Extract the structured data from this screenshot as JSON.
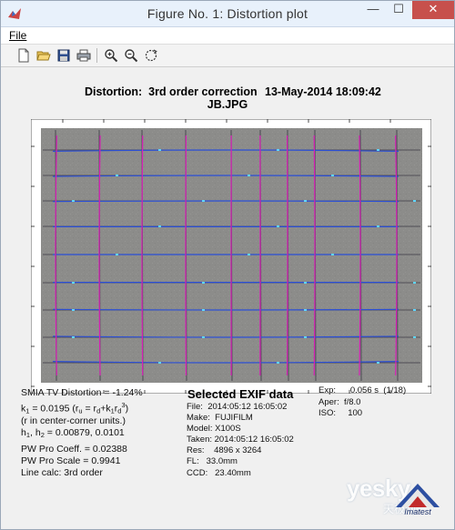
{
  "window": {
    "title": "Figure No. 1: Distortion plot"
  },
  "window_controls": {
    "minimize": "—",
    "maximize": "☐",
    "close": "✕"
  },
  "menu": {
    "file": "File"
  },
  "toolbar": {
    "icons": [
      "new-file-icon",
      "open-folder-icon",
      "save-disk-icon",
      "print-icon",
      "zoom-in-icon",
      "zoom-out-icon",
      "rotate-icon"
    ]
  },
  "plot": {
    "title_line1": "Distortion:  3rd order correction",
    "date": "13-May-2014 18:09:42",
    "file": "JB.JPG",
    "line_colors": {
      "horizontal": "#2b4fd6",
      "vertical": "#d81fb7",
      "highlight": "#5fd6ff"
    }
  },
  "stats": {
    "smia": "SMIA TV Distortion = -1.24%",
    "k1_prefix": "k",
    "k1_sub": "1",
    "k1_value": " = 0.0195  (r",
    "k1_ru_sub": "u",
    "k1_eq": " = r",
    "k1_rd_sub": "d",
    "k1_plus": "+k",
    "k1_k_sub": "1",
    "k1_r": "r",
    "k1_rd3": "d",
    "k1_exp": "3",
    "k1_close": ")",
    "r_units": "(r in center-corner units.)",
    "h_prefix": "h",
    "h1_sub": "1",
    "h_mid": ", h",
    "h2_sub": "2",
    "h_values": " = 0.00879, 0.0101",
    "pw_coeff": "PW Pro Coeff. = 0.02388",
    "pw_scale": "PW Pro Scale = 0.9941",
    "line_calc": "Line calc: 3rd order"
  },
  "exif": {
    "title": "Selected EXIF data",
    "lines": [
      "File:  2014:05:12 16:05:02",
      "Make:  FUJIFILM",
      "Model: X100S",
      "Taken: 2014:05:12 16:05:02",
      "Res:    4896 x 3264",
      "FL:   33.0mm",
      "CCD:   23.40mm"
    ]
  },
  "camera": {
    "lines": [
      "Exp:      0.056 s  (1/18)",
      "Aper:  f/8.0",
      "ISO:     100"
    ]
  },
  "watermark": {
    "text": "yesky",
    "sub": "天极网",
    "logo": "Imatest"
  }
}
